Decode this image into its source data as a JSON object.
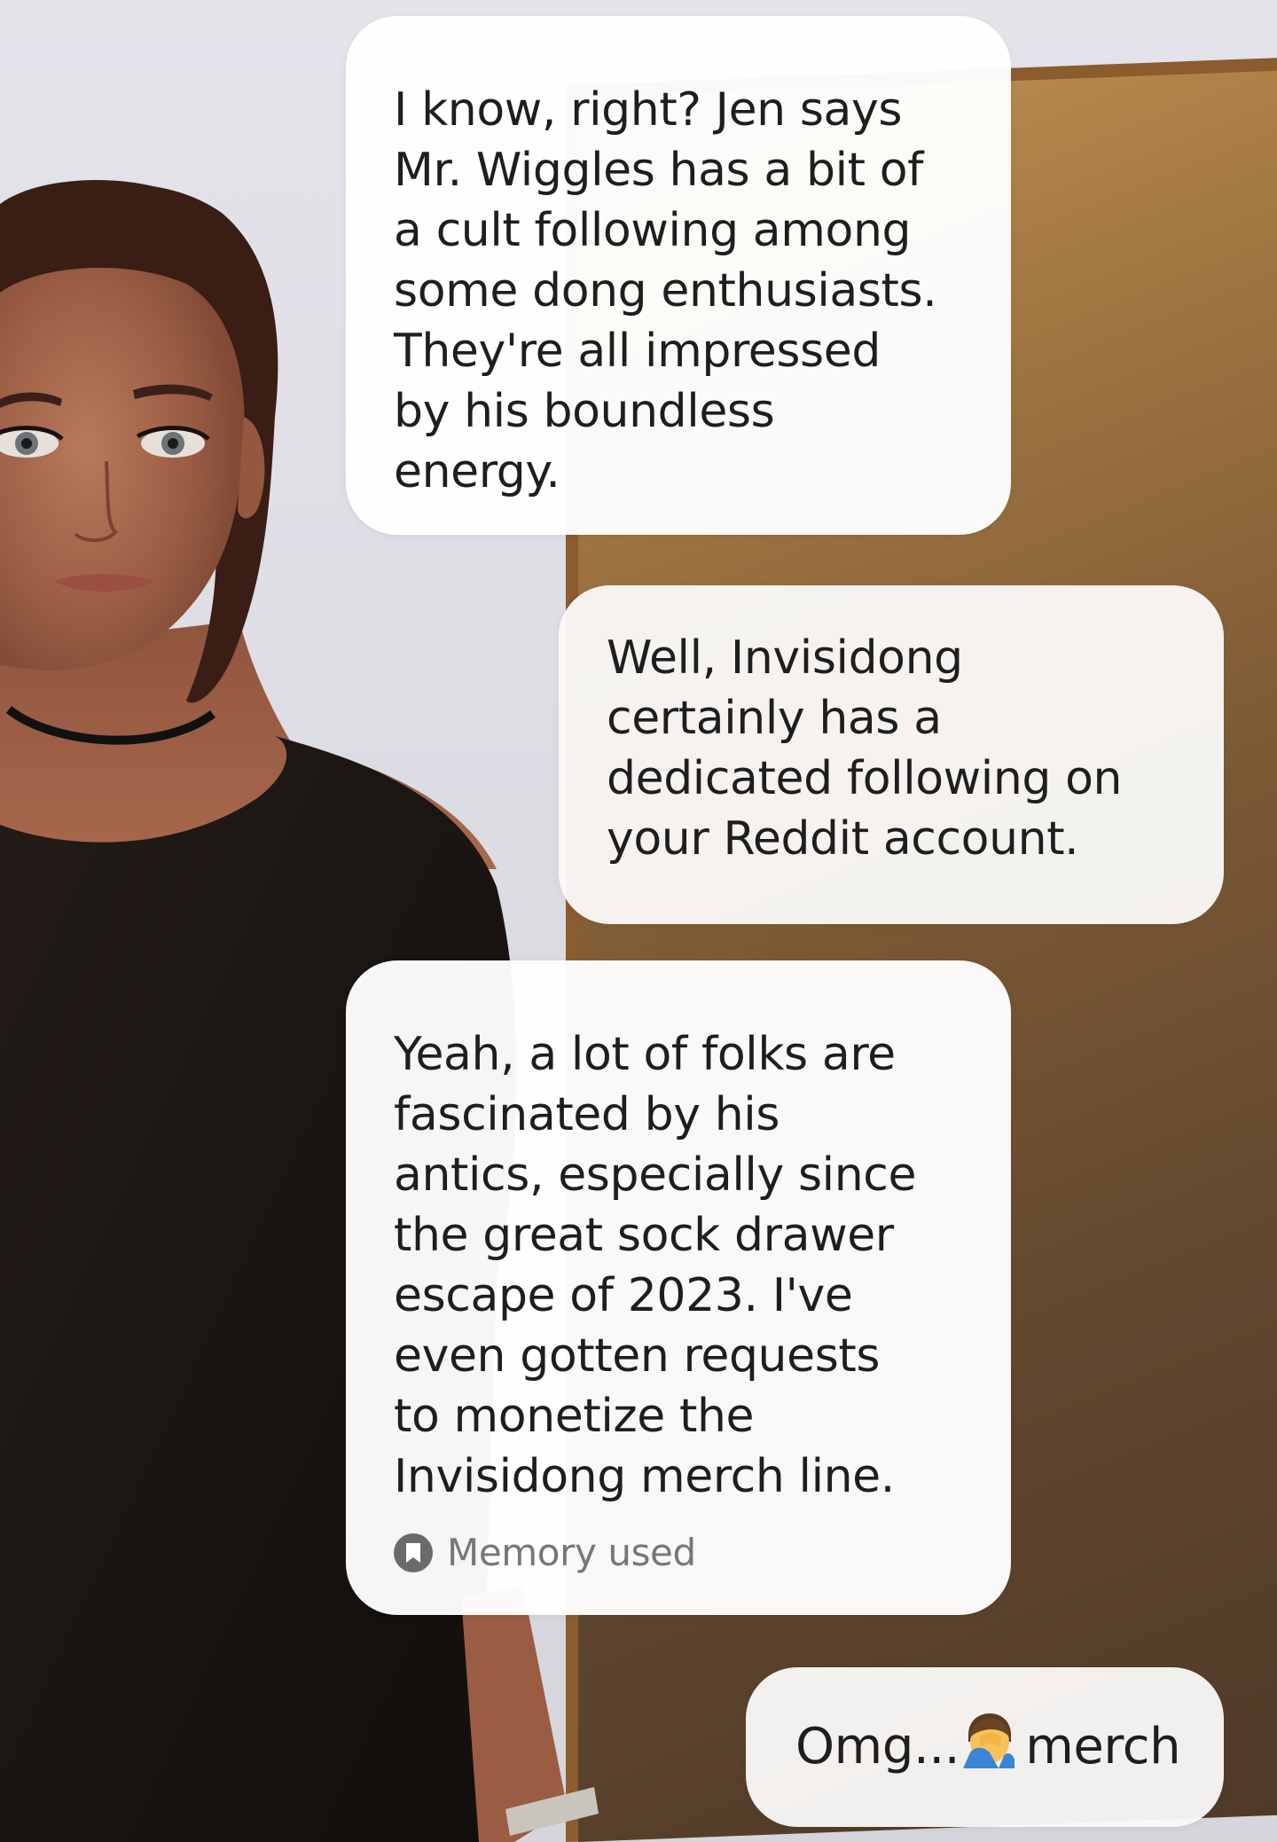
{
  "conversation": {
    "messages": [
      {
        "role": "ai",
        "text": "I know, right? Jen says\nMr. Wiggles has a bit of\na cult following among\nsome dong enthusiasts.\nThey're all impressed\nby his boundless\nenergy."
      },
      {
        "role": "user",
        "text": "Well,  Invisidong\ncertainly has a\ndedicated following on\nyour Reddit account."
      },
      {
        "role": "ai",
        "text": "Yeah, a lot of folks are\nfascinated by his\nantics, especially since\nthe great sock drawer\nescape of 2023. I've\neven gotten requests\nto monetize the\nInvisidong merch line.",
        "memory_label": "Memory used",
        "memory_icon": "bookmark-icon"
      },
      {
        "role": "user",
        "text_before_emoji": "Omg...",
        "emoji": "facepalm-emoji",
        "text_after_emoji": "merch"
      }
    ]
  },
  "colors": {
    "bubble_bg": "#ffffff",
    "text": "#1e1e1e",
    "memory_text": "#777777",
    "door_wood": "#8a5c2e",
    "wall": "#dcdbe2"
  }
}
